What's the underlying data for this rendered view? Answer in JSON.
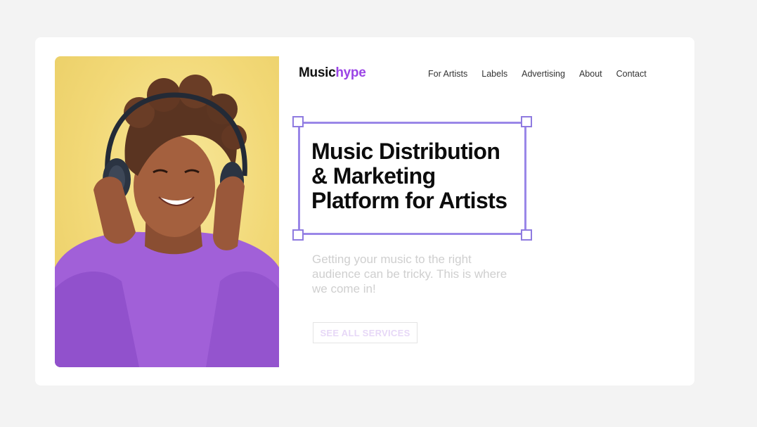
{
  "brand": {
    "part1": "Music",
    "part2": "hype"
  },
  "nav": [
    "For Artists",
    "Labels",
    "Advertising",
    "About",
    "Contact"
  ],
  "hero": {
    "headline_lines": [
      "Music Distribution",
      "& Marketing",
      "Platform for Artists"
    ],
    "subtext": "Getting your music to the right audience can be tricky.  This is where we come in!",
    "cta_label": "SEE ALL SERVICES"
  },
  "colors": {
    "accent": "#9b45e6",
    "selection": "#9a87e8",
    "photo_bg": "#f2d876",
    "sweater": "#a060d6"
  },
  "icons": {
    "selection_handle": "square-handle-icon"
  }
}
